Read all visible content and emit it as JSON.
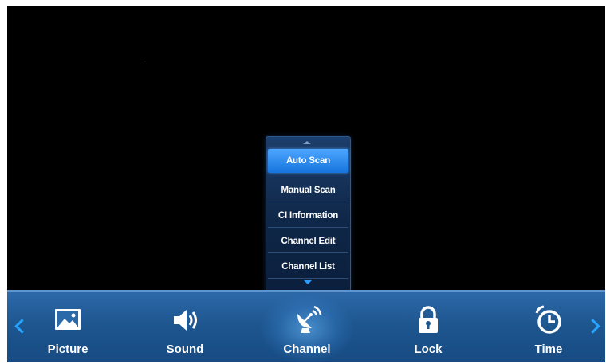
{
  "submenu": {
    "items": [
      {
        "label": "Auto Scan",
        "selected": true
      },
      {
        "label": "Manual Scan",
        "selected": false
      },
      {
        "label": "CI Information",
        "selected": false
      },
      {
        "label": "Channel Edit",
        "selected": false
      },
      {
        "label": "Channel List",
        "selected": false
      }
    ],
    "scroll_up_icon": "triangle-up-icon",
    "scroll_down_icon": "triangle-down-icon"
  },
  "main_menu": {
    "items": [
      {
        "label": "Picture",
        "icon": "picture-icon"
      },
      {
        "label": "Sound",
        "icon": "speaker-icon"
      },
      {
        "label": "Channel",
        "icon": "satellite-dish-icon",
        "active": true
      },
      {
        "label": "Lock",
        "icon": "padlock-icon"
      },
      {
        "label": "Time",
        "icon": "alarm-clock-icon"
      }
    ],
    "prev_icon": "chevron-left-icon",
    "next_icon": "chevron-right-icon"
  },
  "colors": {
    "bar": "#1e568f",
    "selected_item": "#2b8cf0",
    "arrow_accent": "#27a4ff",
    "background": "#000000"
  }
}
